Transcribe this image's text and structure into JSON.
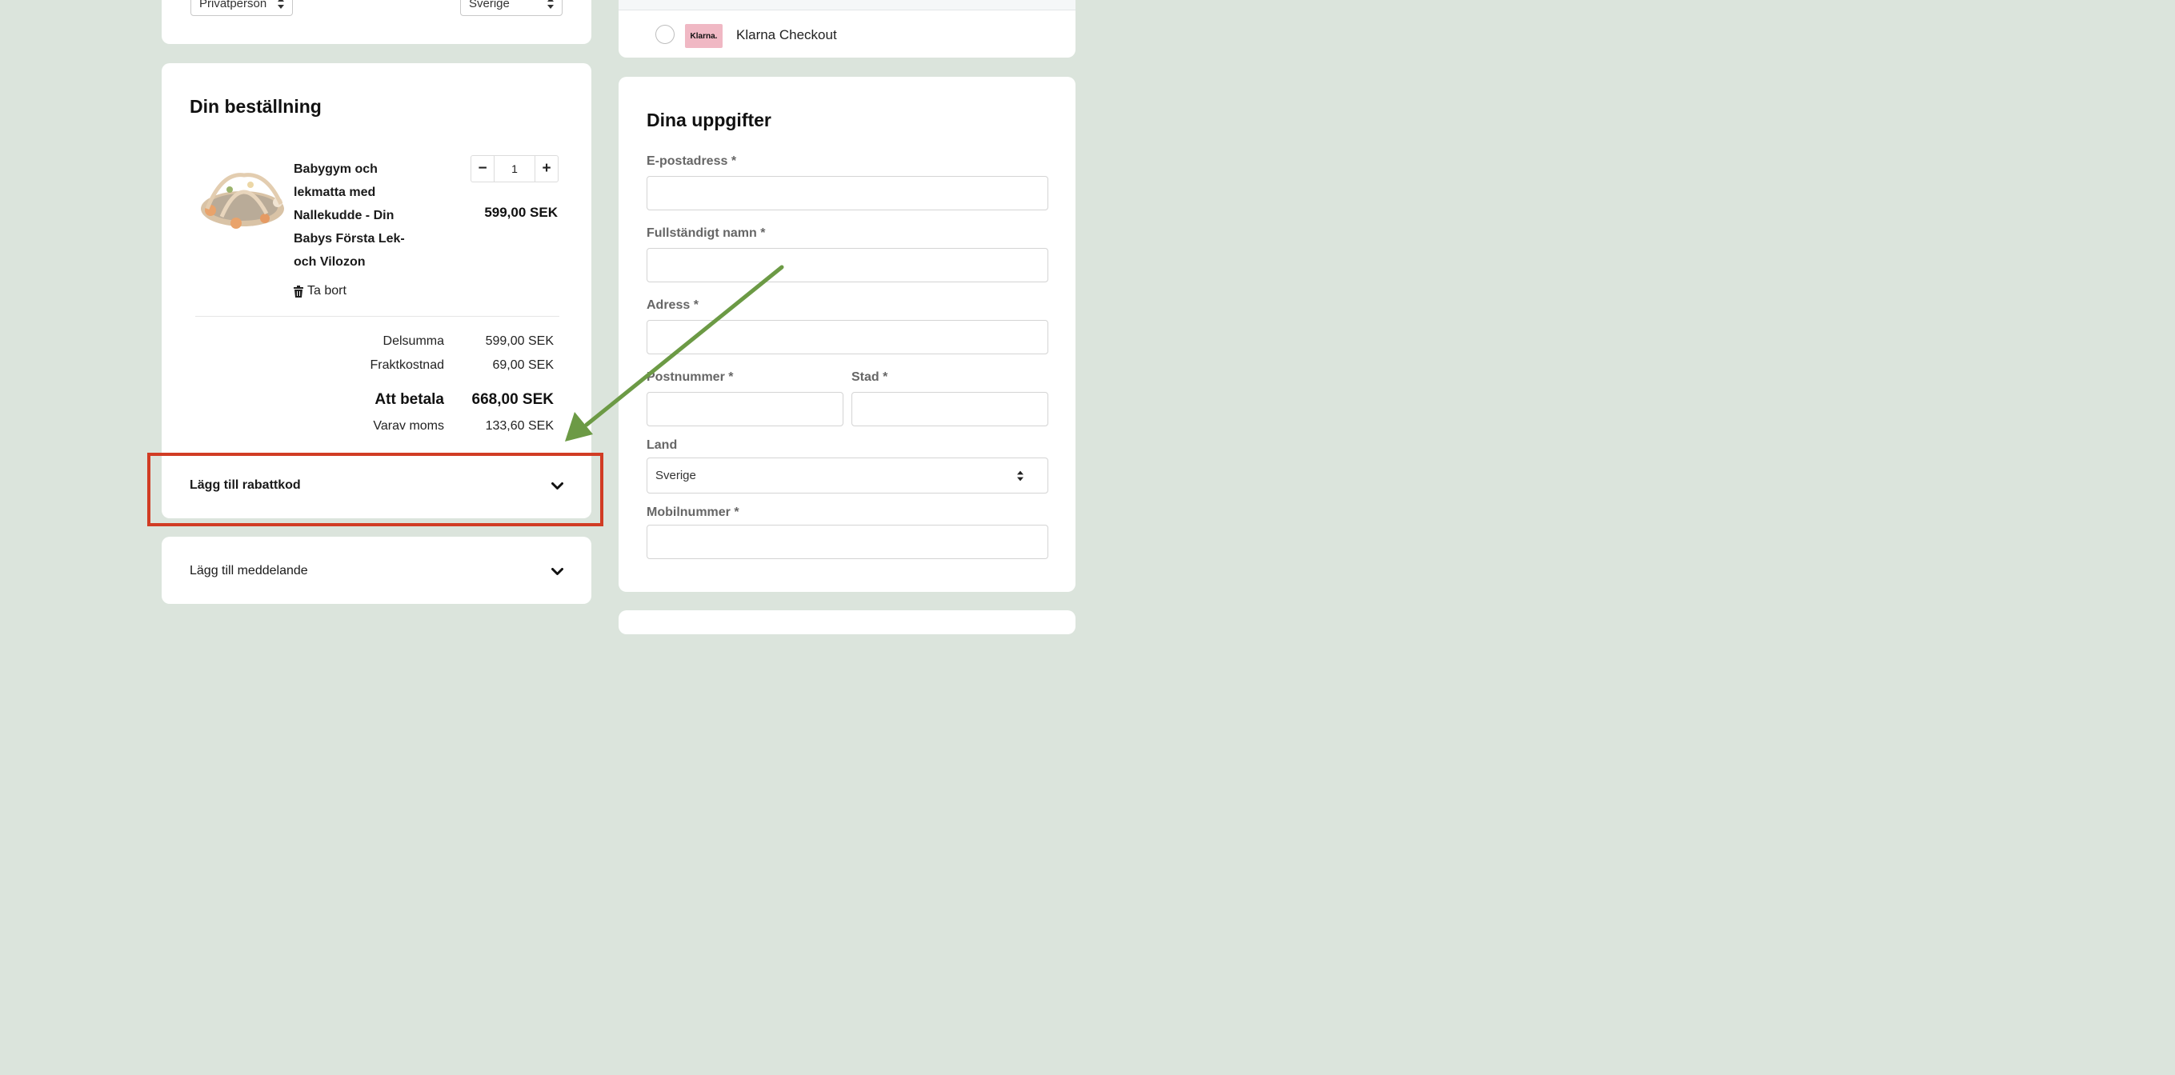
{
  "top": {
    "customer_type": "Privatperson",
    "country": "Sverige",
    "payment_method": "Klarna Checkout",
    "klarna_logo_text": "Klarna."
  },
  "order": {
    "title": "Din beställning",
    "item": {
      "name_lines": [
        "Babygym och",
        "lekmatta med",
        "Nallekudde - Din",
        "Babys Första Lek-",
        "och Vilozon"
      ],
      "quantity": "1",
      "minus": "−",
      "plus": "+",
      "price": "599,00 SEK",
      "remove_label": "Ta bort"
    },
    "subtotal_label": "Delsumma",
    "subtotal_value": "599,00 SEK",
    "shipping_label": "Fraktkostnad",
    "shipping_value": "69,00 SEK",
    "total_label": "Att betala",
    "total_value": "668,00 SEK",
    "vat_label": "Varav moms",
    "vat_value": "133,60 SEK"
  },
  "discount": {
    "label": "Lägg till rabattkod"
  },
  "message": {
    "label": "Lägg till meddelande"
  },
  "details": {
    "title": "Dina uppgifter",
    "email_label": "E-postadress *",
    "name_label": "Fullständigt namn *",
    "address_label": "Adress *",
    "postal_label": "Postnummer *",
    "city_label": "Stad *",
    "country_label": "Land",
    "country_value": "Sverige",
    "phone_label": "Mobilnummer *"
  },
  "colors": {
    "background": "#dbe4dc",
    "highlight": "#d13c24",
    "arrow": "#6c9a45",
    "klarna_pink": "#f0b8c4"
  }
}
